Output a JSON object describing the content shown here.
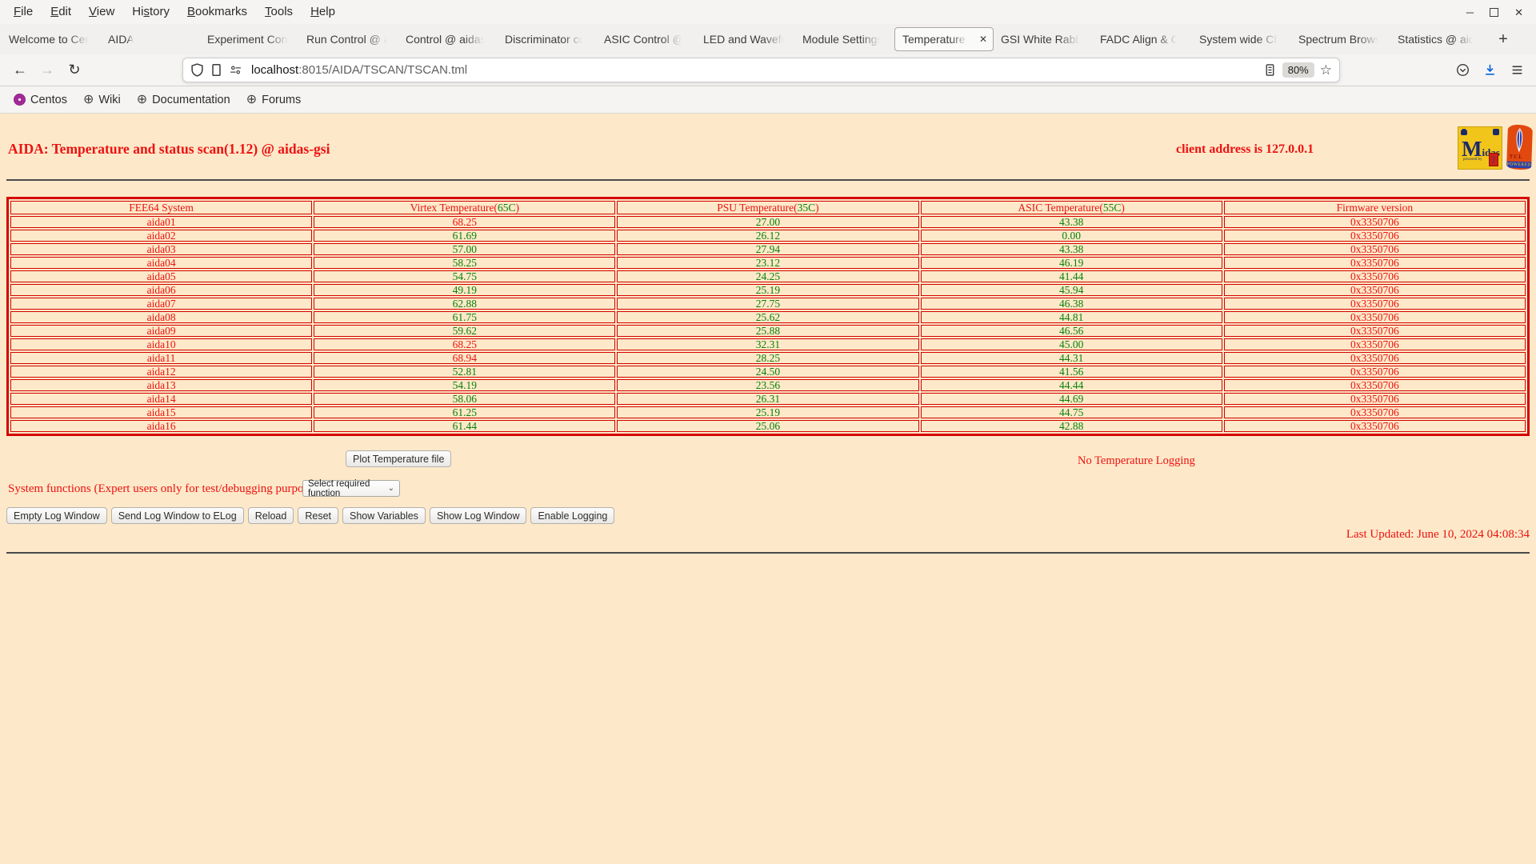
{
  "browser": {
    "menu_items": [
      {
        "label": "File",
        "accel": 0
      },
      {
        "label": "Edit",
        "accel": 0
      },
      {
        "label": "View",
        "accel": 0
      },
      {
        "label": "History",
        "accel": 2
      },
      {
        "label": "Bookmarks",
        "accel": 0
      },
      {
        "label": "Tools",
        "accel": 0
      },
      {
        "label": "Help",
        "accel": 0
      }
    ],
    "tabs": [
      {
        "label": "Welcome to Cen"
      },
      {
        "label": "AIDA"
      },
      {
        "label": "Experiment Cont"
      },
      {
        "label": "Run Control @ a"
      },
      {
        "label": "Control @ aidas"
      },
      {
        "label": "Discriminator co"
      },
      {
        "label": "ASIC Control @"
      },
      {
        "label": "LED and Wavefo"
      },
      {
        "label": "Module Settings"
      },
      {
        "label": "Temperature a",
        "active": true
      },
      {
        "label": "GSI White Rabb"
      },
      {
        "label": "FADC Align & C"
      },
      {
        "label": "System wide Ch"
      },
      {
        "label": "Spectrum Brows"
      },
      {
        "label": "Statistics @ aid"
      }
    ],
    "new_tab": "+",
    "nav": {
      "url_host": "localhost",
      "url_rest": ":8015/AIDA/TSCAN/TSCAN.tml",
      "zoom_level": "80%"
    },
    "bookmarks": [
      "Centos",
      "Wiki",
      "Documentation",
      "Forums"
    ]
  },
  "page": {
    "colors": {
      "background": "#fde9c9",
      "text_red": "#ee1111",
      "value_green": "#0a800a",
      "table_border": "#d40000"
    },
    "title": "AIDA: Temperature and status scan(1.12) @ aidas-gsi",
    "client_address": "client address is 127.0.0.1",
    "table": {
      "columns": [
        {
          "label": "FEE64 System"
        },
        {
          "prefix": "Virtex Temperature(",
          "limit": "65C",
          "suffix": ")",
          "threshold": 65
        },
        {
          "prefix": "PSU Temperature(",
          "limit": "35C",
          "suffix": ")",
          "threshold": 35
        },
        {
          "prefix": "ASIC Temperature(",
          "limit": "55C",
          "suffix": ")",
          "threshold": 55
        },
        {
          "label": "Firmware version"
        }
      ],
      "rows": [
        {
          "system": "aida01",
          "virtex": "68.25",
          "psu": "27.00",
          "asic": "43.38",
          "firmware": "0x3350706"
        },
        {
          "system": "aida02",
          "virtex": "61.69",
          "psu": "26.12",
          "asic": "0.00",
          "firmware": "0x3350706"
        },
        {
          "system": "aida03",
          "virtex": "57.00",
          "psu": "27.94",
          "asic": "43.38",
          "firmware": "0x3350706"
        },
        {
          "system": "aida04",
          "virtex": "58.25",
          "psu": "23.12",
          "asic": "46.19",
          "firmware": "0x3350706"
        },
        {
          "system": "aida05",
          "virtex": "54.75",
          "psu": "24.25",
          "asic": "41.44",
          "firmware": "0x3350706"
        },
        {
          "system": "aida06",
          "virtex": "49.19",
          "psu": "25.19",
          "asic": "45.94",
          "firmware": "0x3350706"
        },
        {
          "system": "aida07",
          "virtex": "62.88",
          "psu": "27.75",
          "asic": "46.38",
          "firmware": "0x3350706"
        },
        {
          "system": "aida08",
          "virtex": "61.75",
          "psu": "25.62",
          "asic": "44.81",
          "firmware": "0x3350706"
        },
        {
          "system": "aida09",
          "virtex": "59.62",
          "psu": "25.88",
          "asic": "46.56",
          "firmware": "0x3350706"
        },
        {
          "system": "aida10",
          "virtex": "68.25",
          "psu": "32.31",
          "asic": "45.00",
          "firmware": "0x3350706"
        },
        {
          "system": "aida11",
          "virtex": "68.94",
          "psu": "28.25",
          "asic": "44.31",
          "firmware": "0x3350706"
        },
        {
          "system": "aida12",
          "virtex": "52.81",
          "psu": "24.50",
          "asic": "41.56",
          "firmware": "0x3350706"
        },
        {
          "system": "aida13",
          "virtex": "54.19",
          "psu": "23.56",
          "asic": "44.44",
          "firmware": "0x3350706"
        },
        {
          "system": "aida14",
          "virtex": "58.06",
          "psu": "26.31",
          "asic": "44.69",
          "firmware": "0x3350706"
        },
        {
          "system": "aida15",
          "virtex": "61.25",
          "psu": "25.19",
          "asic": "44.75",
          "firmware": "0x3350706"
        },
        {
          "system": "aida16",
          "virtex": "61.44",
          "psu": "25.06",
          "asic": "42.88",
          "firmware": "0x3350706"
        }
      ]
    },
    "plot_button": "Plot Temperature file",
    "logging_status": "No Temperature Logging",
    "system_functions_label": "System functions (Expert users only for test/debugging purposes!!!)",
    "function_select_value": "Select required function",
    "action_buttons": [
      "Empty Log Window",
      "Send Log Window to ELog",
      "Reload",
      "Reset",
      "Show Variables",
      "Show Log Window",
      "Enable Logging"
    ],
    "last_updated": "Last Updated: June 10, 2024 04:08:34",
    "logos": {
      "midas": "Midas",
      "midas_powered": "powered by",
      "tcl_name": "TCL",
      "tcl_powered": "POWERED"
    }
  }
}
